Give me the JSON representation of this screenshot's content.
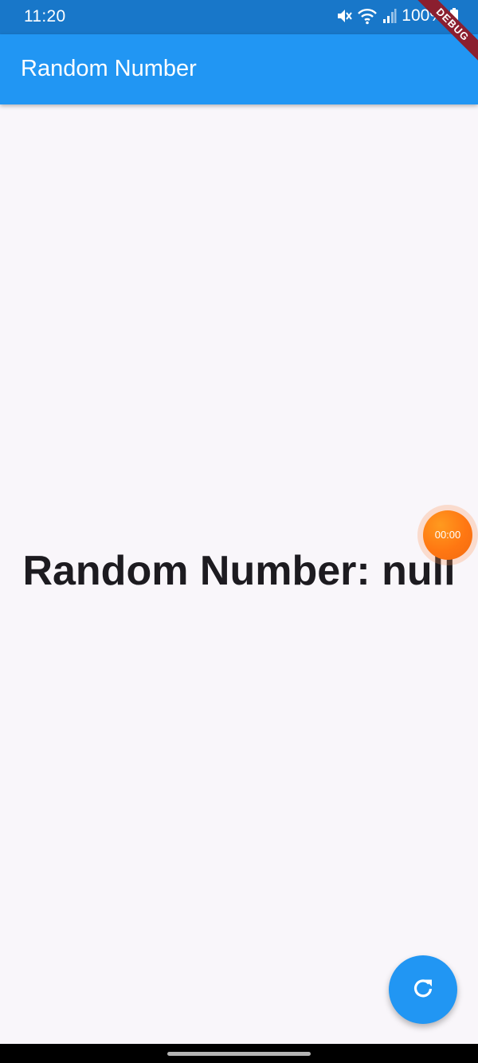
{
  "status_bar": {
    "time": "11:20",
    "battery_percent": "100%",
    "icons": [
      "mute-icon",
      "wifi-icon",
      "signal-icon",
      "battery-icon"
    ]
  },
  "debug_banner": "DEBUG",
  "app_bar": {
    "title": "Random Number"
  },
  "main": {
    "text": "Random Number: null"
  },
  "recorder": {
    "timer": "00:00"
  },
  "fab": {
    "icon": "refresh-icon"
  },
  "colors": {
    "status_bar": "#1877c9",
    "app_bar": "#2196f3",
    "background": "#f9f6fa",
    "fab": "#2196f3",
    "timer_bubble": "#ff7712",
    "debug_ribbon": "#8b1f2f"
  }
}
